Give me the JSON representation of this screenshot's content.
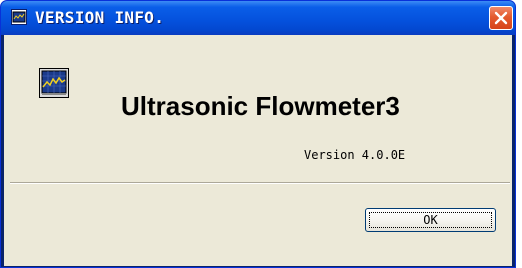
{
  "window": {
    "title": "VERSION INFO.",
    "title_icon": "monitor-graph-icon",
    "close_icon": "close-icon"
  },
  "dialog": {
    "app_icon": "flowmeter-graph-icon",
    "app_name": "Ultrasonic Flowmeter3",
    "version": "Version 4.0.0E",
    "ok_label": "OK"
  },
  "colors": {
    "titlebar": "#0450dc",
    "client_background": "#ece9d8",
    "close_button": "#e45a2e",
    "icon_screen": "#1a3a8a",
    "icon_trace": "#f0d020"
  }
}
